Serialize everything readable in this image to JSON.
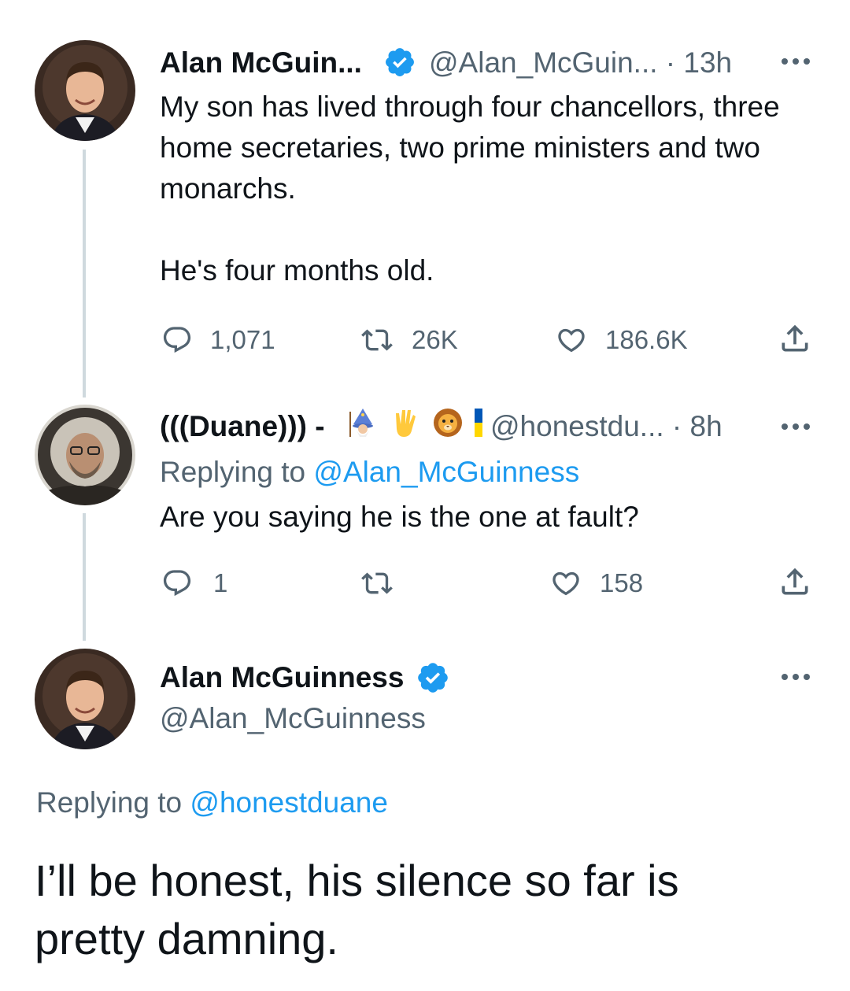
{
  "tweet1": {
    "display_name": "Alan McGuin...",
    "handle_time": "@Alan_McGuin... · 13h",
    "text": "My son has lived through four chancellors, three\nhome secretaries, two prime ministers and two\nmonarchs.\n\nHe's four months old.",
    "replies": "1,071",
    "retweets": "26K",
    "likes": "186.6K"
  },
  "tweet2": {
    "display_name": "(((Duane))) -",
    "handle_time": "@honestdu... · 8h",
    "replying_prefix": "Replying to ",
    "replying_handle": "@Alan_McGuinness",
    "text": "Are you saying he is the one at fault?",
    "replies": "1",
    "retweets": "",
    "likes": "158"
  },
  "tweet3": {
    "display_name": "Alan McGuinness",
    "handle": "@Alan_McGuinness",
    "replying_prefix": "Replying to ",
    "replying_handle": "@honestduane",
    "text": "I’ll be honest, his silence so far is\npretty damning."
  },
  "icons": {
    "verified": "verified-badge-icon",
    "reply": "reply-icon",
    "retweet": "retweet-icon",
    "like": "heart-icon",
    "share": "share-icon",
    "more": "more-icon",
    "emoji": [
      "mage-emoji",
      "vulcan-salute-emoji",
      "lion-emoji",
      "ukraine-flag-emoji"
    ]
  },
  "colors": {
    "accent": "#1d9bf0",
    "muted": "#536471",
    "text": "#0f1419",
    "thread_line": "#cfd9de"
  }
}
